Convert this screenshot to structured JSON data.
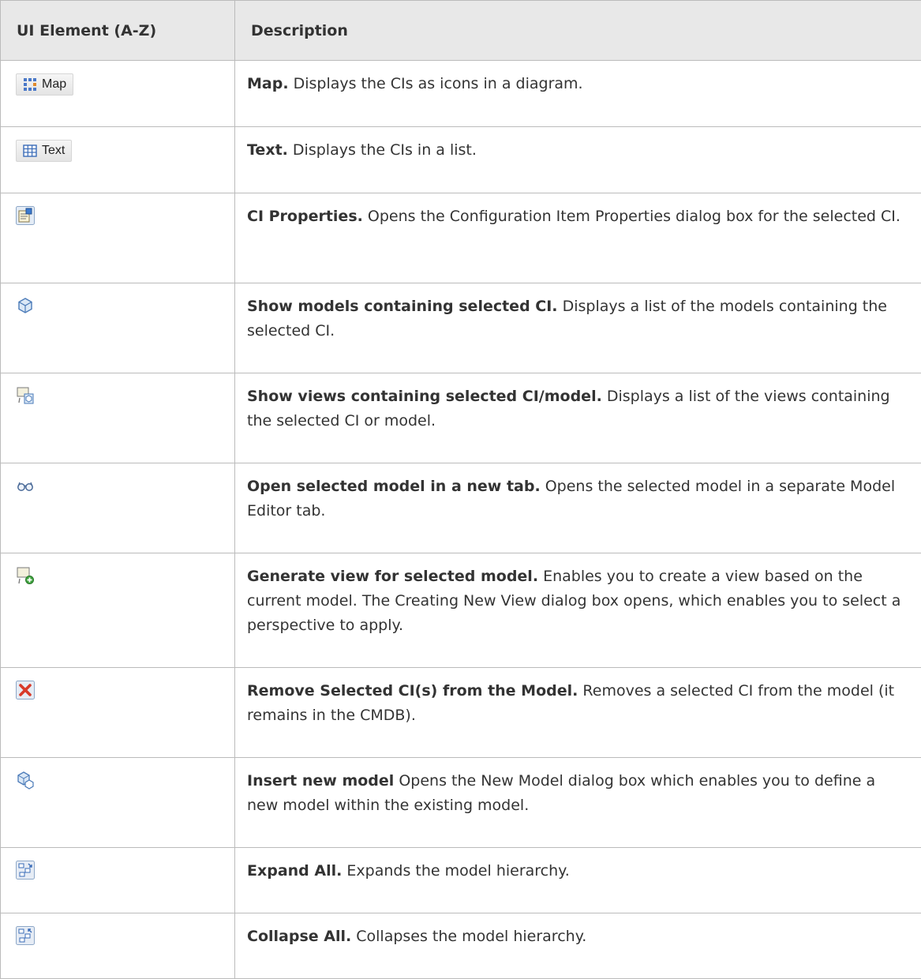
{
  "header": {
    "col1": "UI Element (A-Z)",
    "col2": "Description"
  },
  "rows": [
    {
      "icon": "map-view-icon",
      "button_label": "Map",
      "bold": "Map.",
      "text": " Displays the CIs as icons in a diagram."
    },
    {
      "icon": "grid-table-icon",
      "button_label": "Text",
      "bold": "Text.",
      "text": " Displays the CIs in a list."
    },
    {
      "icon": "ci-properties-icon",
      "bold": "CI Properties.",
      "text": " Opens the Configuration Item Properties dialog box for the selected CI."
    },
    {
      "icon": "model-cube-icon",
      "bold": "Show models containing selected CI.",
      "text": " Displays a list of the models containing the selected CI."
    },
    {
      "icon": "views-containing-icon",
      "bold": "Show views containing selected CI/model.",
      "text": " Displays a list of the views containing the selected CI or model."
    },
    {
      "icon": "glasses-icon",
      "bold": "Open selected model in a new tab.",
      "text": " Opens the selected model in a separate Model Editor tab."
    },
    {
      "icon": "generate-view-icon",
      "bold": "Generate view for selected model.",
      "text": " Enables you to create a view based on the current model. The Creating New View dialog box opens, which enables you to select a perspective to apply."
    },
    {
      "icon": "remove-x-icon",
      "bold": "Remove Selected CI(s) from the Model.",
      "text": " Removes a selected CI from the model (it remains in the CMDB)."
    },
    {
      "icon": "insert-model-icon",
      "bold": "Insert new model",
      "text": " Opens the New Model dialog box which enables you to define a new model within the existing model."
    },
    {
      "icon": "expand-all-icon",
      "bold": "Expand All.",
      "text": " Expands the model hierarchy."
    },
    {
      "icon": "collapse-all-icon",
      "bold": "Collapse All.",
      "text": " Collapses the model hierarchy."
    }
  ]
}
